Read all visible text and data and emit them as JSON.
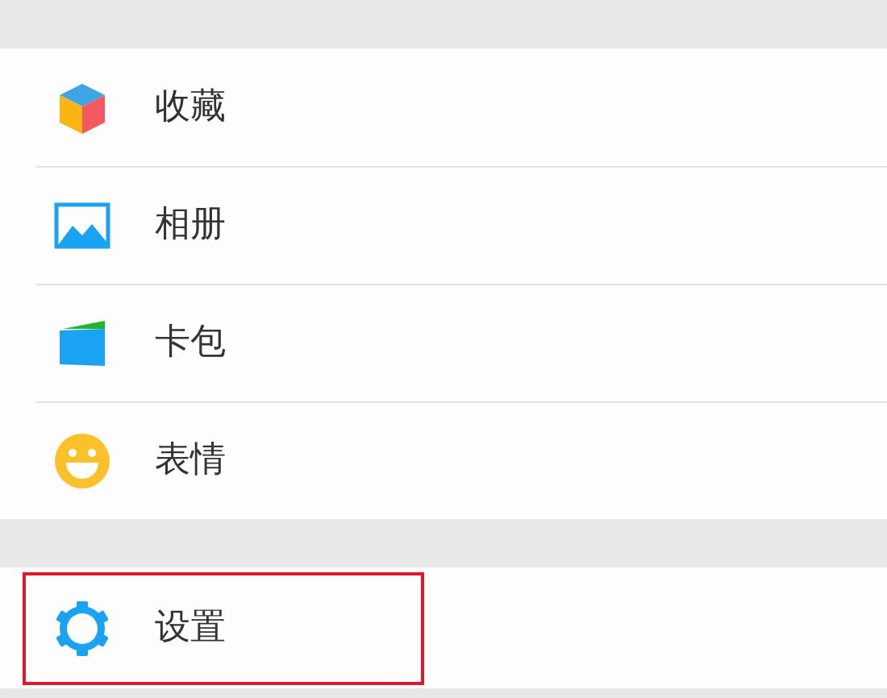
{
  "sections": [
    {
      "items": [
        {
          "kind": "cube",
          "label": "收藏",
          "highlighted": false
        },
        {
          "kind": "photo",
          "label": "相册",
          "highlighted": false
        },
        {
          "kind": "wallet",
          "label": "卡包",
          "highlighted": false
        },
        {
          "kind": "smile",
          "label": "表情",
          "highlighted": false
        }
      ]
    },
    {
      "items": [
        {
          "kind": "gear",
          "label": "设置",
          "highlighted": true
        }
      ]
    }
  ]
}
